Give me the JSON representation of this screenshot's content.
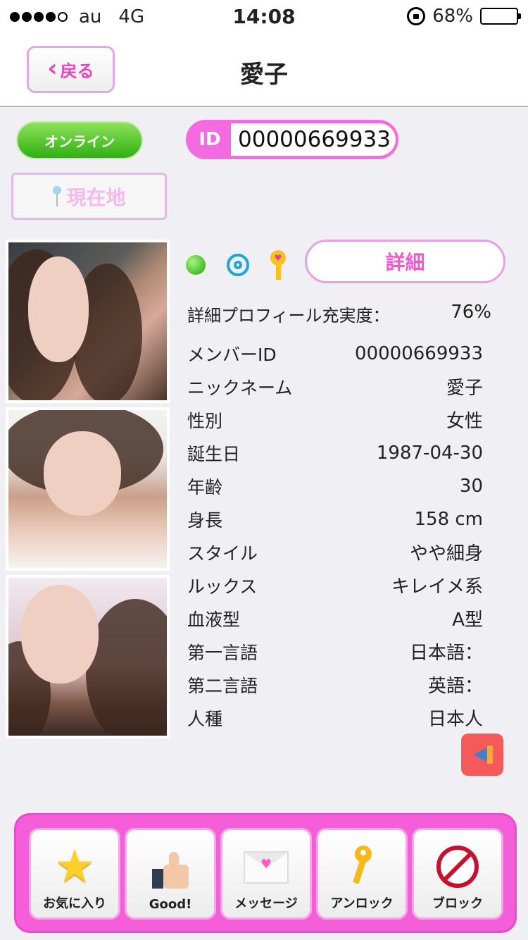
{
  "status_bar": {
    "carrier": "au",
    "network": "4G",
    "time": "14:08",
    "battery": "68%",
    "battery_level": 0.68,
    "signal_bars_filled": 4,
    "signal_bars_total": 5
  },
  "nav": {
    "back_label": "戻る",
    "title": "愛子"
  },
  "profile": {
    "online_label": "オンライン",
    "location_label": "現在地",
    "id_label": "ID",
    "id_value": "00000669933",
    "details_button": "詳細",
    "completeness_label": "詳細プロフィール充実度：",
    "completeness_value": "76%"
  },
  "info_rows": [
    {
      "label": "メンバーID",
      "value": "00000669933"
    },
    {
      "label": "ニックネーム",
      "value": "愛子"
    },
    {
      "label": "性別",
      "value": "女性"
    },
    {
      "label": "誕生日",
      "value": "1987-04-30"
    },
    {
      "label": "年齢",
      "value": "30"
    },
    {
      "label": "身長",
      "value": "158 cm"
    },
    {
      "label": "スタイル",
      "value": "やや細身"
    },
    {
      "label": "ルックス",
      "value": "キレイメ系"
    },
    {
      "label": "血液型",
      "value": "A型"
    },
    {
      "label": "第一言語",
      "value": "日本語："
    },
    {
      "label": "第二言語",
      "value": "英語："
    },
    {
      "label": "人種",
      "value": "日本人"
    }
  ],
  "actions": {
    "favorite": "お気に入り",
    "good": "Good!",
    "message": "メッセージ",
    "unlock": "アンロック",
    "block": "ブロック"
  },
  "colors": {
    "accent_pink": "#f45ed8",
    "online_green": "#2fb012",
    "block_red": "#c8102e"
  }
}
